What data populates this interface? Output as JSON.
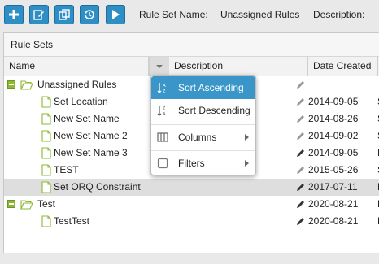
{
  "toolbar": {
    "buttons": [
      "add-icon",
      "edit-icon",
      "copy-icon",
      "history-icon",
      "run-icon"
    ],
    "rule_set_name_label": "Rule Set Name:",
    "rule_set_name_value": "Unassigned Rules",
    "description_label": "Description:"
  },
  "panel": {
    "title": "Rule Sets",
    "columns": {
      "name": "Name",
      "description": "Description",
      "date_created": "Date Created"
    }
  },
  "rows": [
    {
      "name": "Unassigned Rules",
      "type": "folder",
      "date": ""
    },
    {
      "name": "Set Location",
      "type": "file",
      "date": "2014-09-05",
      "extra": "S"
    },
    {
      "name": "New Set Name",
      "type": "file",
      "date": "2014-08-26",
      "extra": "S"
    },
    {
      "name": "New Set Name 2",
      "type": "file",
      "date": "2014-09-02",
      "extra": "S"
    },
    {
      "name": "New Set Name 3",
      "type": "file",
      "date": "2014-09-05",
      "extra": "D"
    },
    {
      "name": "TEST",
      "type": "file",
      "date": "2015-05-26",
      "extra": "S"
    },
    {
      "name": "Set ORQ Constraint",
      "type": "file",
      "date": "2017-07-11",
      "extra": "D"
    },
    {
      "name": "Test",
      "type": "folder",
      "date": "2020-08-21",
      "extra": "D"
    },
    {
      "name": "TestTest",
      "type": "file",
      "date": "2020-08-21",
      "extra": "D"
    }
  ],
  "column_menu": {
    "sort_ascending": "Sort Ascending",
    "sort_descending": "Sort Descending",
    "columns": "Columns",
    "filters": "Filters"
  },
  "colors": {
    "accent": "#3a96c8",
    "toolbar_button": "#2f8fc4",
    "expander": "#8cb832",
    "selected_row": "#dedede"
  }
}
